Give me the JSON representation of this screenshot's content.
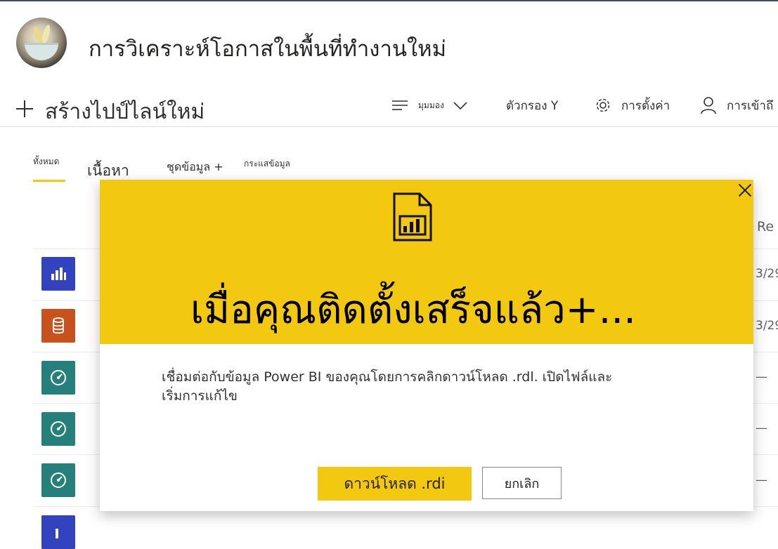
{
  "workspace": {
    "title": "การวิเคราะห์โอกาสในพื้นที่ทำงานใหม่"
  },
  "commandbar": {
    "new_pipeline": "สร้างไปป์ไลน์ใหม่",
    "view": "มุมมอง",
    "filter": "ตัวกรอง Y",
    "settings": "การตั้งค่า",
    "access": "การเข้าถึ"
  },
  "tabs": {
    "all": "ทั้งหมด",
    "content": "เนื้อหา",
    "datasets": "ชุดข้อมูล +",
    "dataflows": "กระแสข้อมูล"
  },
  "list": {
    "column_header": "Re",
    "rows": [
      {
        "icon": "report-icon",
        "color": "#3343c0",
        "value": "3/29"
      },
      {
        "icon": "dataset-icon",
        "color": "#c8521d",
        "value": "3/29"
      },
      {
        "icon": "dashboard-icon",
        "color": "#257f7a",
        "value": "—"
      },
      {
        "icon": "dashboard-icon",
        "color": "#257f7a",
        "value": "—"
      },
      {
        "icon": "dashboard-icon",
        "color": "#257f7a",
        "value": "—"
      },
      {
        "icon": "report-icon",
        "color": "#3343c0",
        "value": ""
      }
    ]
  },
  "dialog": {
    "title": "เมื่อคุณติดตั้งเสร็จแล้ว+...",
    "description_line1": "เชื่อมต่อกับข้อมูล Power BI ของคุณโดยการคลิกดาวน์โหลด .rdl. เปิดไฟล์และ",
    "description_line2": "เริ่มการแก้ไข",
    "download_button": "ดาวน์โหลด .rdi",
    "cancel_button": "ยกเลิก",
    "header_color": "#f2c811"
  }
}
